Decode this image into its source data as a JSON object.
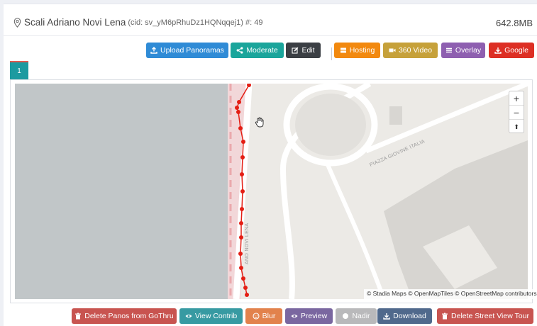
{
  "header": {
    "title": "Scali Adriano Novi Lena",
    "cid": "(cid: sv_yM6pRhuDz1HQNqqej1)",
    "count": "#: 49",
    "size": "642.8MB"
  },
  "toolbar": {
    "upload": "Upload Panoramas",
    "moderate": "Moderate",
    "edit": "Edit",
    "hosting": "Hosting",
    "video": "360 Video",
    "overlay": "Overlay",
    "google": "Google"
  },
  "tabs": [
    "1"
  ],
  "map": {
    "zoom_in": "+",
    "zoom_out": "−",
    "reset": "⬆",
    "street_1": "PIAZZA GIOVINE ITALIA",
    "street_2": "ANO NOVI LENA",
    "attribution": "© Stadia Maps © OpenMapTiles © OpenStreetMap contributors"
  },
  "actions": {
    "delete_panos": "Delete Panos from GoThru",
    "view_contrib": "View Contrib",
    "blur": "Blur",
    "preview": "Preview",
    "nadir": "Nadir",
    "download": "Download",
    "delete_sv": "Delete Street View Tour"
  },
  "colors": {
    "track": "#e41e14",
    "tab": "#1c9aa0"
  }
}
